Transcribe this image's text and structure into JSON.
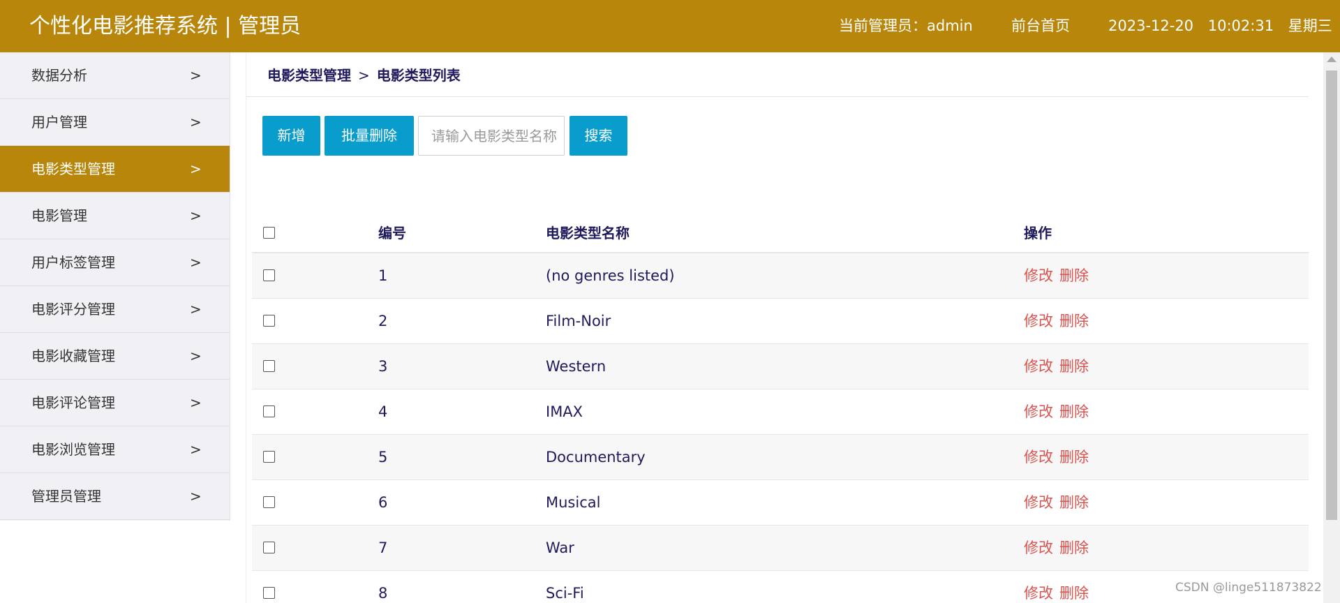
{
  "header": {
    "title": "个性化电影推荐系统 | 管理员",
    "admin_info": "当前管理员：admin",
    "home_link": "前台首页",
    "date": "2023-12-20",
    "time": "10:02:31",
    "weekday": "星期三"
  },
  "sidebar": {
    "items": [
      {
        "label": "数据分析",
        "active": false
      },
      {
        "label": "用户管理",
        "active": false
      },
      {
        "label": "电影类型管理",
        "active": true
      },
      {
        "label": "电影管理",
        "active": false
      },
      {
        "label": "用户标签管理",
        "active": false
      },
      {
        "label": "电影评分管理",
        "active": false
      },
      {
        "label": "电影收藏管理",
        "active": false
      },
      {
        "label": "电影评论管理",
        "active": false
      },
      {
        "label": "电影浏览管理",
        "active": false
      },
      {
        "label": "管理员管理",
        "active": false
      }
    ],
    "chevron": ">"
  },
  "breadcrumb": {
    "parent": "电影类型管理",
    "separator": ">",
    "current": "电影类型列表"
  },
  "toolbar": {
    "add_label": "新增",
    "batch_delete_label": "批量删除",
    "search_placeholder": "请输入电影类型名称",
    "search_value": "",
    "search_label": "搜索"
  },
  "table": {
    "headers": {
      "id": "编号",
      "name": "电影类型名称",
      "ops": "操作"
    },
    "edit_label": "修改",
    "delete_label": "删除",
    "rows": [
      {
        "id": "1",
        "name": "(no genres listed)"
      },
      {
        "id": "2",
        "name": "Film-Noir"
      },
      {
        "id": "3",
        "name": "Western"
      },
      {
        "id": "4",
        "name": "IMAX"
      },
      {
        "id": "5",
        "name": "Documentary"
      },
      {
        "id": "6",
        "name": "Musical"
      },
      {
        "id": "7",
        "name": "War"
      },
      {
        "id": "8",
        "name": "Sci-Fi"
      }
    ]
  },
  "colors": {
    "header_bg": "#b8860b",
    "button_bg": "#099dcd",
    "link_red": "#d9534f",
    "text_dark": "#1f1a5c"
  },
  "watermark": "CSDN @linge511873822"
}
